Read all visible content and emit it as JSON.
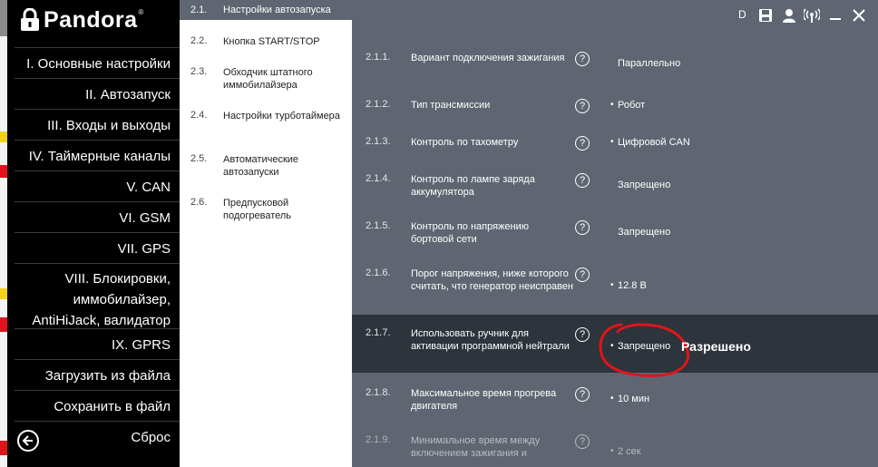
{
  "app": {
    "logo_text": "Pandora",
    "reg_mark": "®"
  },
  "left_menu": [
    "I. Основные настройки",
    "II. Автозапуск",
    "III. Входы и выходы",
    "IV. Таймерные каналы",
    "V. CAN",
    "VI. GSM",
    "VII. GPS",
    "VIII. Блокировки,",
    "иммобилайзер,",
    "AntiHiJack, валидатор",
    "IX. GPRS",
    "Загрузить из файла",
    "Сохранить в файл",
    "Сброс"
  ],
  "submenu": [
    {
      "num": "2.1.",
      "label": "Настройки автозапуска"
    },
    {
      "num": "2.2.",
      "label": "Кнопка START/STOP"
    },
    {
      "num": "2.3.",
      "label": "Обходчик штатного иммобилайзера"
    },
    {
      "num": "2.4.",
      "label": "Настройки турботаймера"
    },
    {
      "num": "2.5.",
      "label": "Автоматические автозапуски"
    },
    {
      "num": "2.6.",
      "label": "Предпусковой подогреватель"
    }
  ],
  "params": [
    {
      "num": "2.1.1.",
      "label": "Вариант подключения зажигания",
      "value": "Параллельно",
      "dot": ""
    },
    {
      "num": "2.1.2.",
      "label": "Тип трансмиссии",
      "value": "Робот",
      "dot": "•"
    },
    {
      "num": "2.1.3.",
      "label": "Контроль по тахометру",
      "value": "Цифровой CAN",
      "dot": "•"
    },
    {
      "num": "2.1.4.",
      "label": "Контроль по лампе заряда аккумулятора",
      "value": "Запрещено",
      "dot": ""
    },
    {
      "num": "2.1.5.",
      "label": "Контроль по напряжению бортовой сети",
      "value": "Запрещено",
      "dot": ""
    },
    {
      "num": "2.1.6.",
      "label": "Порог напряжения, ниже которого считать, что генератор неисправен",
      "value": "12.8  В",
      "dot": "•"
    },
    {
      "num": "2.1.7.",
      "label": "Использовать ручник для активации программной нейтрали",
      "value": "Запрещено",
      "dot": "•"
    },
    {
      "num": "2.1.8.",
      "label": "Максимальное время прогрева двигателя",
      "value": "10  мин",
      "dot": "•"
    },
    {
      "num": "2.1.9.",
      "label": "Минимальное время между включением зажигания и",
      "value": "2  сек",
      "dot": "•"
    }
  ],
  "help_glyph": "?",
  "annotation": "Разрешено",
  "toolbar": {
    "device_letter": "D"
  },
  "colors": {
    "menu_bg": "#000000",
    "panel_bg": "#5f6671",
    "selected_bg": "#2d343c",
    "annotation_red": "#e0141c"
  }
}
